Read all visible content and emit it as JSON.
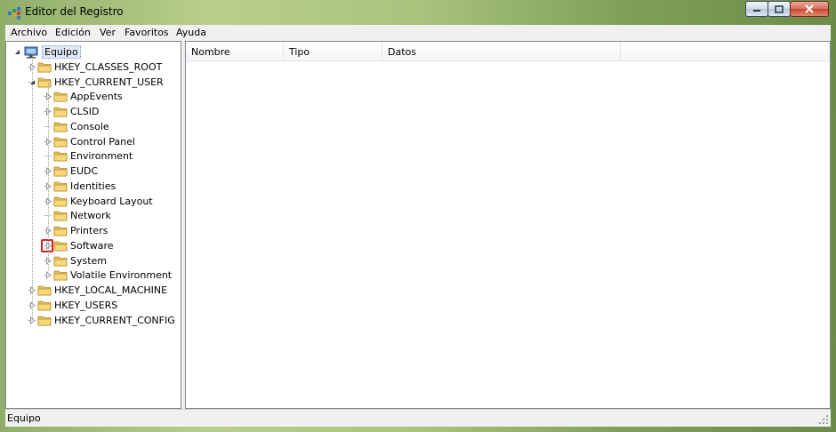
{
  "window": {
    "title": "Editor del Registro",
    "icon": "registry-editor-icon"
  },
  "menu": [
    "Archivo",
    "Edición",
    "Ver",
    "Favoritos",
    "Ayuda"
  ],
  "tree": {
    "root": "Equipo",
    "hives": [
      {
        "name": "HKEY_CLASSES_ROOT",
        "expanded": false
      },
      {
        "name": "HKEY_CURRENT_USER",
        "expanded": true,
        "children": [
          {
            "name": "AppEvents",
            "has_children": true
          },
          {
            "name": "CLSID",
            "has_children": true
          },
          {
            "name": "Console",
            "has_children": false
          },
          {
            "name": "Control Panel",
            "has_children": true
          },
          {
            "name": "Environment",
            "has_children": false
          },
          {
            "name": "EUDC",
            "has_children": true
          },
          {
            "name": "Identities",
            "has_children": true
          },
          {
            "name": "Keyboard Layout",
            "has_children": true
          },
          {
            "name": "Network",
            "has_children": false
          },
          {
            "name": "Printers",
            "has_children": true
          },
          {
            "name": "Software",
            "has_children": true,
            "highlighted": true
          },
          {
            "name": "System",
            "has_children": true
          },
          {
            "name": "Volatile Environment",
            "has_children": true
          }
        ]
      },
      {
        "name": "HKEY_LOCAL_MACHINE",
        "expanded": false
      },
      {
        "name": "HKEY_USERS",
        "expanded": false
      },
      {
        "name": "HKEY_CURRENT_CONFIG",
        "expanded": false
      }
    ]
  },
  "list": {
    "columns": [
      "Nombre",
      "Tipo",
      "Datos"
    ]
  },
  "status": "Equipo",
  "colors": {
    "highlight": "#d2232a",
    "folder": "#e8c15a"
  }
}
